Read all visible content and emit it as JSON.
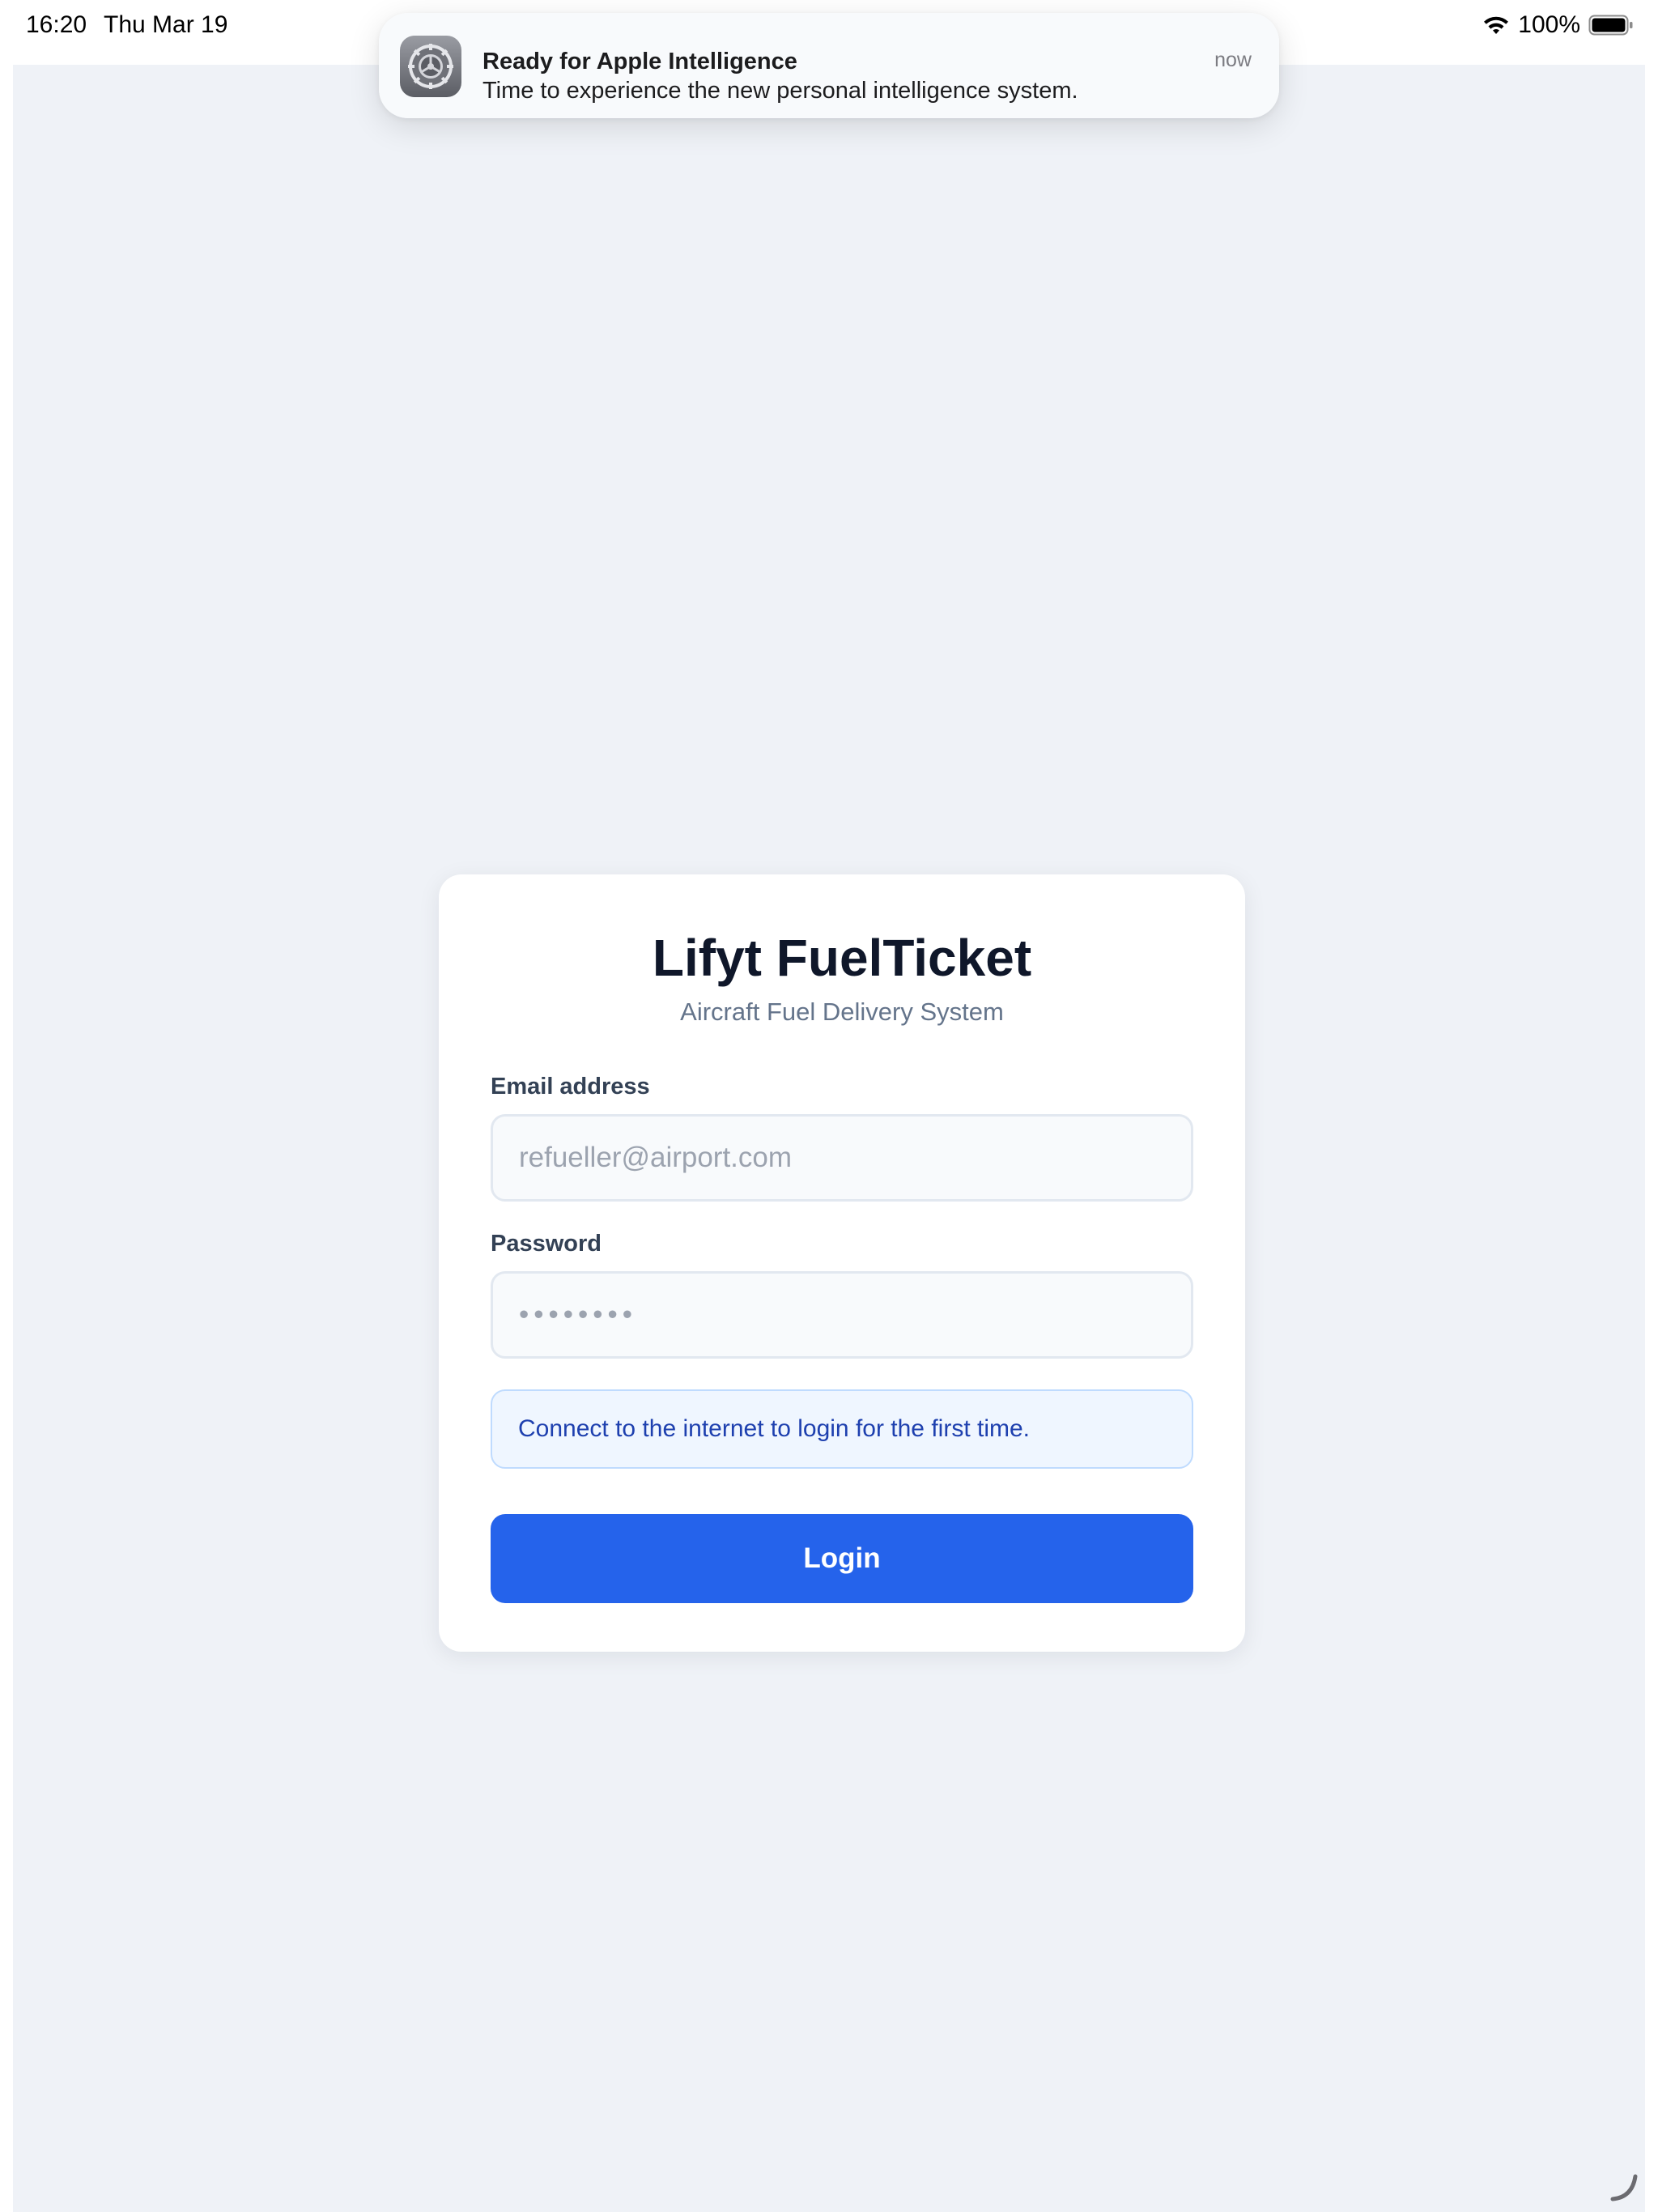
{
  "status_bar": {
    "time": "16:20",
    "date": "Thu Mar 19",
    "battery": "100%",
    "wifi_icon": "wifi-icon",
    "battery_icon": "battery-icon"
  },
  "notification": {
    "icon": "settings-gear-icon",
    "title": "Ready for Apple Intelligence",
    "body": "Time to experience the new personal intelligence system.",
    "time": "now"
  },
  "login": {
    "title": "Lifyt FuelTicket",
    "subtitle": "Aircraft Fuel Delivery System",
    "email_label": "Email address",
    "email_placeholder": "refueller@airport.com",
    "email_value": "",
    "password_label": "Password",
    "password_placeholder": "••••••••",
    "password_value": "",
    "info_message": "Connect to the internet to login for the first time.",
    "button_label": "Login"
  },
  "colors": {
    "background": "#eff2f7",
    "card": "#ffffff",
    "primary": "#2563eb",
    "info_bg": "#eff6ff",
    "info_text": "#1e40af"
  }
}
